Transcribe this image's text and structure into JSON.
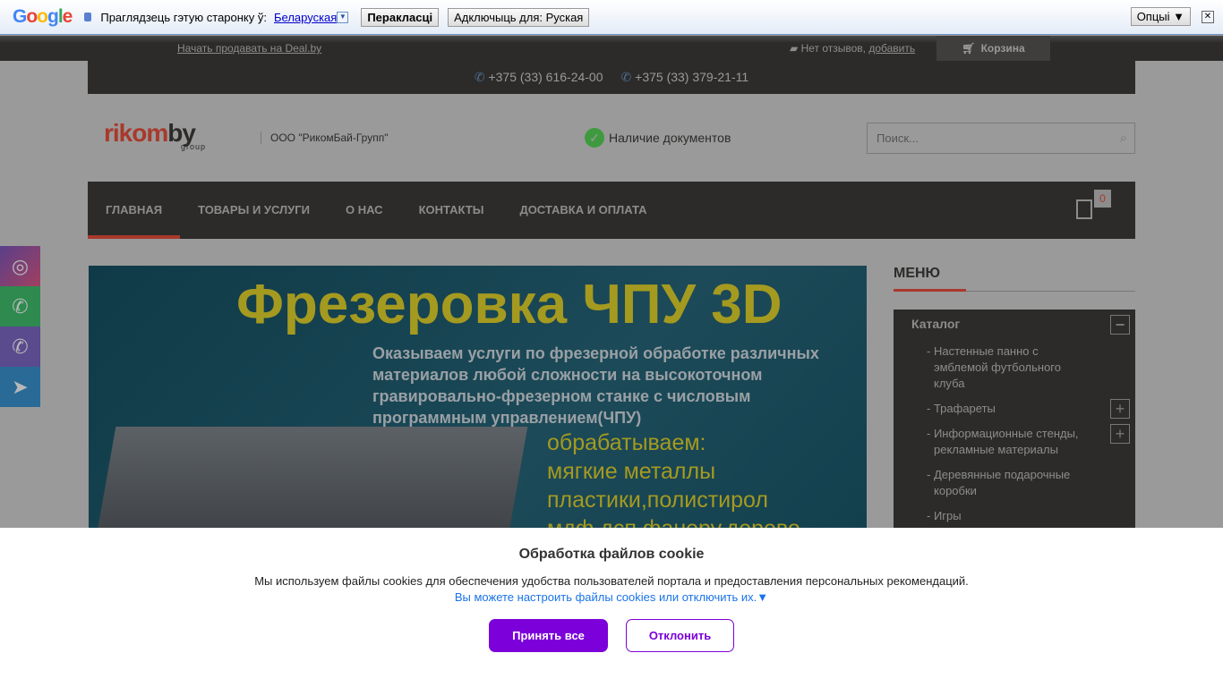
{
  "translate_bar": {
    "prompt": "Праглядзець гэтую старонку ў:",
    "language": "Беларуская",
    "translate_button": "Перакласці",
    "disable_button": "Адключыць для: Руская",
    "options_button": "Опцыі ▼",
    "close": "✕"
  },
  "topbar": {
    "sell_link": "Начать продавать на Deal.by",
    "reviews_text": "Нет отзывов, ",
    "reviews_add": "добавить",
    "cart_label": "Корзина"
  },
  "phones": [
    "+375 (33) 616-24-00",
    "+375 (33) 379-21-11"
  ],
  "header": {
    "logo": "rikomby",
    "company": "ООО \"РикомБай-Групп\"",
    "documents": "Наличие документов",
    "search_placeholder": "Поиск..."
  },
  "nav": {
    "items": [
      "ГЛАВНАЯ",
      "ТОВАРЫ И УСЛУГИ",
      "О НАС",
      "КОНТАКТЫ",
      "ДОСТАВКА И ОПЛАТА"
    ],
    "cart_count": "0"
  },
  "banner": {
    "title": "Фрезеровка ЧПУ 3D",
    "description": "Оказываем услуги по фрезерной обработке различных материалов любой сложности на высокоточном гравировально-фрезерном станке с числовым программным управлением(ЧПУ)",
    "list": [
      "обрабатываем:",
      "мягкие металлы",
      "пластики,полистирол",
      "мдф,дсп,фанеру,дерево"
    ]
  },
  "sidebar": {
    "title": "МЕНЮ",
    "catalog": "Каталог",
    "items": [
      {
        "label": "Настенные панно с эмблемой футбольного клуба",
        "expandable": false
      },
      {
        "label": "Трафареты",
        "expandable": true
      },
      {
        "label": "Информационные стенды, рекламные материалы",
        "expandable": true
      },
      {
        "label": "Деревянные подарочные коробки",
        "expandable": false
      },
      {
        "label": "Игры",
        "expandable": false
      }
    ]
  },
  "cookie": {
    "title": "Обработка файлов cookie",
    "description": "Мы используем файлы cookies для обеспечения удобства пользователей портала и предоставления персональных рекомендаций.",
    "settings_link": "Вы можете настроить файлы cookies или отключить их.▼",
    "accept": "Принять все",
    "reject": "Отклонить"
  },
  "colors": {
    "accent": "#a8392c",
    "cookie_button": "#7b00d9",
    "link": "#1a73e8"
  }
}
